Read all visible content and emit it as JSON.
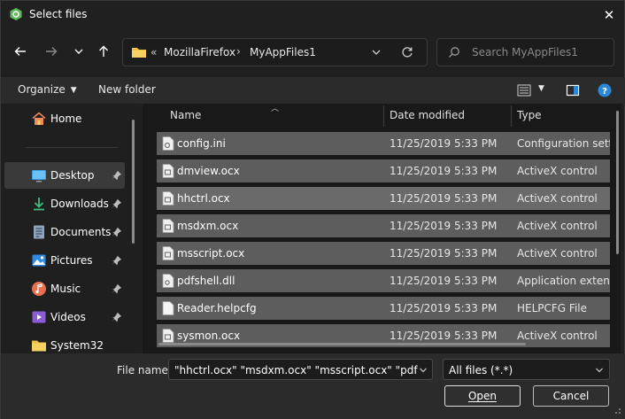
{
  "window": {
    "title": "Select files",
    "close_label": "✕"
  },
  "address_bar": {
    "overflow": "«",
    "segments": [
      "MozillaFirefox",
      "MyAppFiles1"
    ],
    "separator": "›"
  },
  "search": {
    "placeholder": "Search MyAppFiles1"
  },
  "toolbar": {
    "organize_label": "Organize",
    "new_folder_label": "New folder"
  },
  "sidebar": {
    "items": [
      {
        "label": "Home",
        "icon": "home-icon",
        "pinned": false
      },
      {
        "label": "Desktop",
        "icon": "desktop-icon",
        "pinned": true,
        "selected": true
      },
      {
        "label": "Downloads",
        "icon": "download-icon",
        "pinned": true
      },
      {
        "label": "Documents",
        "icon": "documents-icon",
        "pinned": true
      },
      {
        "label": "Pictures",
        "icon": "pictures-icon",
        "pinned": true
      },
      {
        "label": "Music",
        "icon": "music-icon",
        "pinned": true
      },
      {
        "label": "Videos",
        "icon": "videos-icon",
        "pinned": true
      },
      {
        "label": "System32",
        "icon": "folder-icon",
        "pinned": false
      }
    ]
  },
  "file_list": {
    "columns": [
      "Name",
      "Date modified",
      "Type"
    ],
    "rows": [
      {
        "name": "config.ini",
        "date": "11/25/2019 5:33 PM",
        "type": "Configuration sett..."
      },
      {
        "name": "dmview.ocx",
        "date": "11/25/2019 5:33 PM",
        "type": "ActiveX control"
      },
      {
        "name": "hhctrl.ocx",
        "date": "11/25/2019 5:33 PM",
        "type": "ActiveX control"
      },
      {
        "name": "msdxm.ocx",
        "date": "11/25/2019 5:33 PM",
        "type": "ActiveX control"
      },
      {
        "name": "msscript.ocx",
        "date": "11/25/2019 5:33 PM",
        "type": "ActiveX control"
      },
      {
        "name": "pdfshell.dll",
        "date": "11/25/2019 5:33 PM",
        "type": "Application exten..."
      },
      {
        "name": "Reader.helpcfg",
        "date": "11/25/2019 5:33 PM",
        "type": "HELPCFG File"
      },
      {
        "name": "sysmon.ocx",
        "date": "11/25/2019 5:33 PM",
        "type": "ActiveX control"
      }
    ]
  },
  "footer": {
    "file_name_label": "File name:",
    "file_name_value": "\"hhctrl.ocx\" \"msdxm.ocx\" \"msscript.ocx\" \"pdfshell.dll\"",
    "filter_value": "All files (*.*)",
    "open_label": "Open",
    "cancel_label": "Cancel"
  },
  "colors": {
    "selection": "#5d5d5d",
    "accent_blue": "#2b88d8",
    "background": "#202020"
  }
}
